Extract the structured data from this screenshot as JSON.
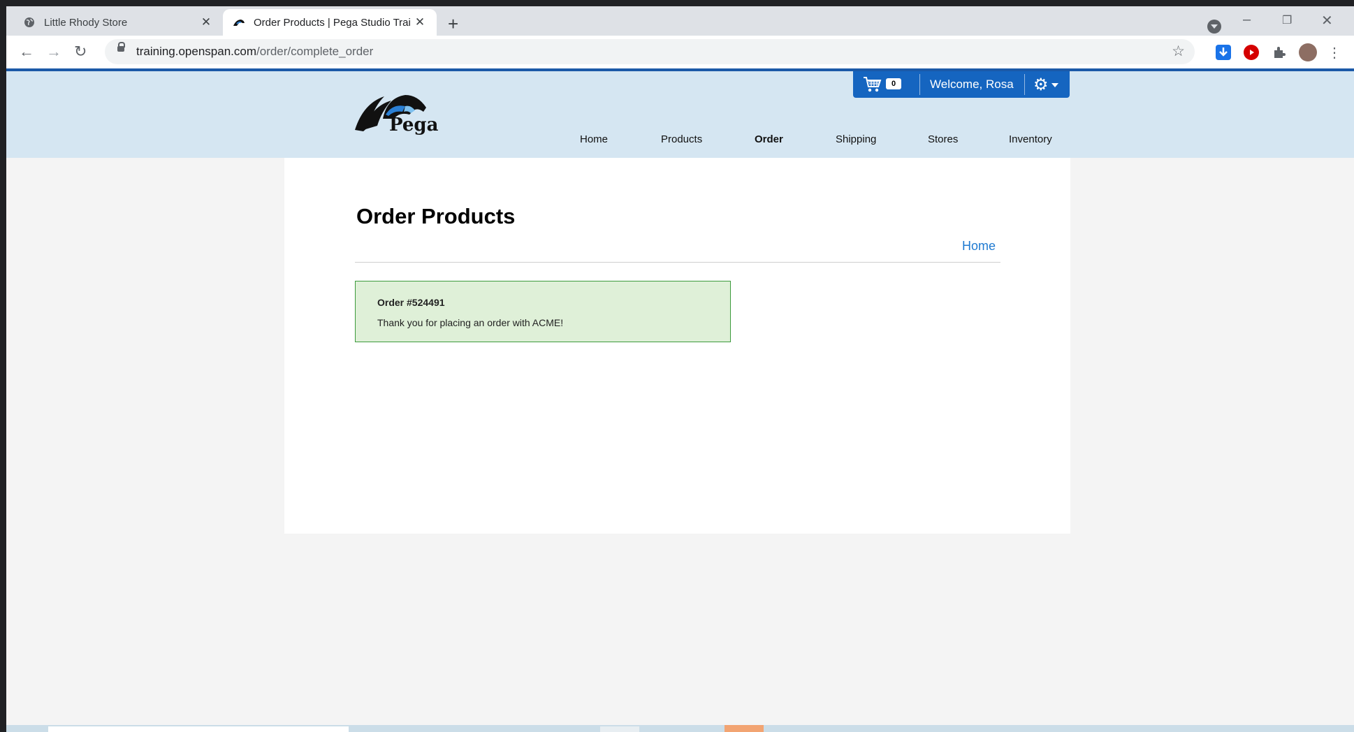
{
  "browser": {
    "tabs": [
      {
        "title": "Little Rhody Store",
        "active": false
      },
      {
        "title": "Order Products | Pega Studio Trai",
        "active": true
      }
    ],
    "new_tab_symbol": "+",
    "tab_close_symbol": "✕",
    "window_controls": {
      "minimize": "–",
      "restore": "❐",
      "close": "✕"
    },
    "url": {
      "domain": "training.openspan.com",
      "path": "/order/complete_order"
    },
    "nav_symbols": {
      "back": "←",
      "forward": "→",
      "reload": "↻"
    },
    "star_symbol": "☆",
    "menu_symbol": "⋮",
    "extensions": [
      {
        "name": "download-extension-icon",
        "color": "#1a73e8"
      },
      {
        "name": "record-extension-icon",
        "color": "#d50000"
      },
      {
        "name": "puzzle-extension-icon",
        "color": "#5f6368"
      },
      {
        "name": "profile-avatar",
        "color": "#8d6e63"
      }
    ]
  },
  "site": {
    "logo_text": "Pega",
    "cart_count": "0",
    "welcome": "Welcome, Rosa",
    "nav": [
      {
        "label": "Home",
        "active": false
      },
      {
        "label": "Products",
        "active": false
      },
      {
        "label": "Order",
        "active": true
      },
      {
        "label": "Shipping",
        "active": false
      },
      {
        "label": "Stores",
        "active": false
      },
      {
        "label": "Inventory",
        "active": false
      }
    ]
  },
  "main": {
    "title": "Order Products",
    "home_link": "Home",
    "message": {
      "order_number": "Order #524491",
      "text": "Thank you for placing an order with ACME!"
    }
  },
  "colors": {
    "header_bg": "#d5e6f2",
    "accent_blue": "#1565c0",
    "link_blue": "#1f7ad1",
    "success_bg": "#dff0d8",
    "success_border": "#3c9a3c"
  }
}
